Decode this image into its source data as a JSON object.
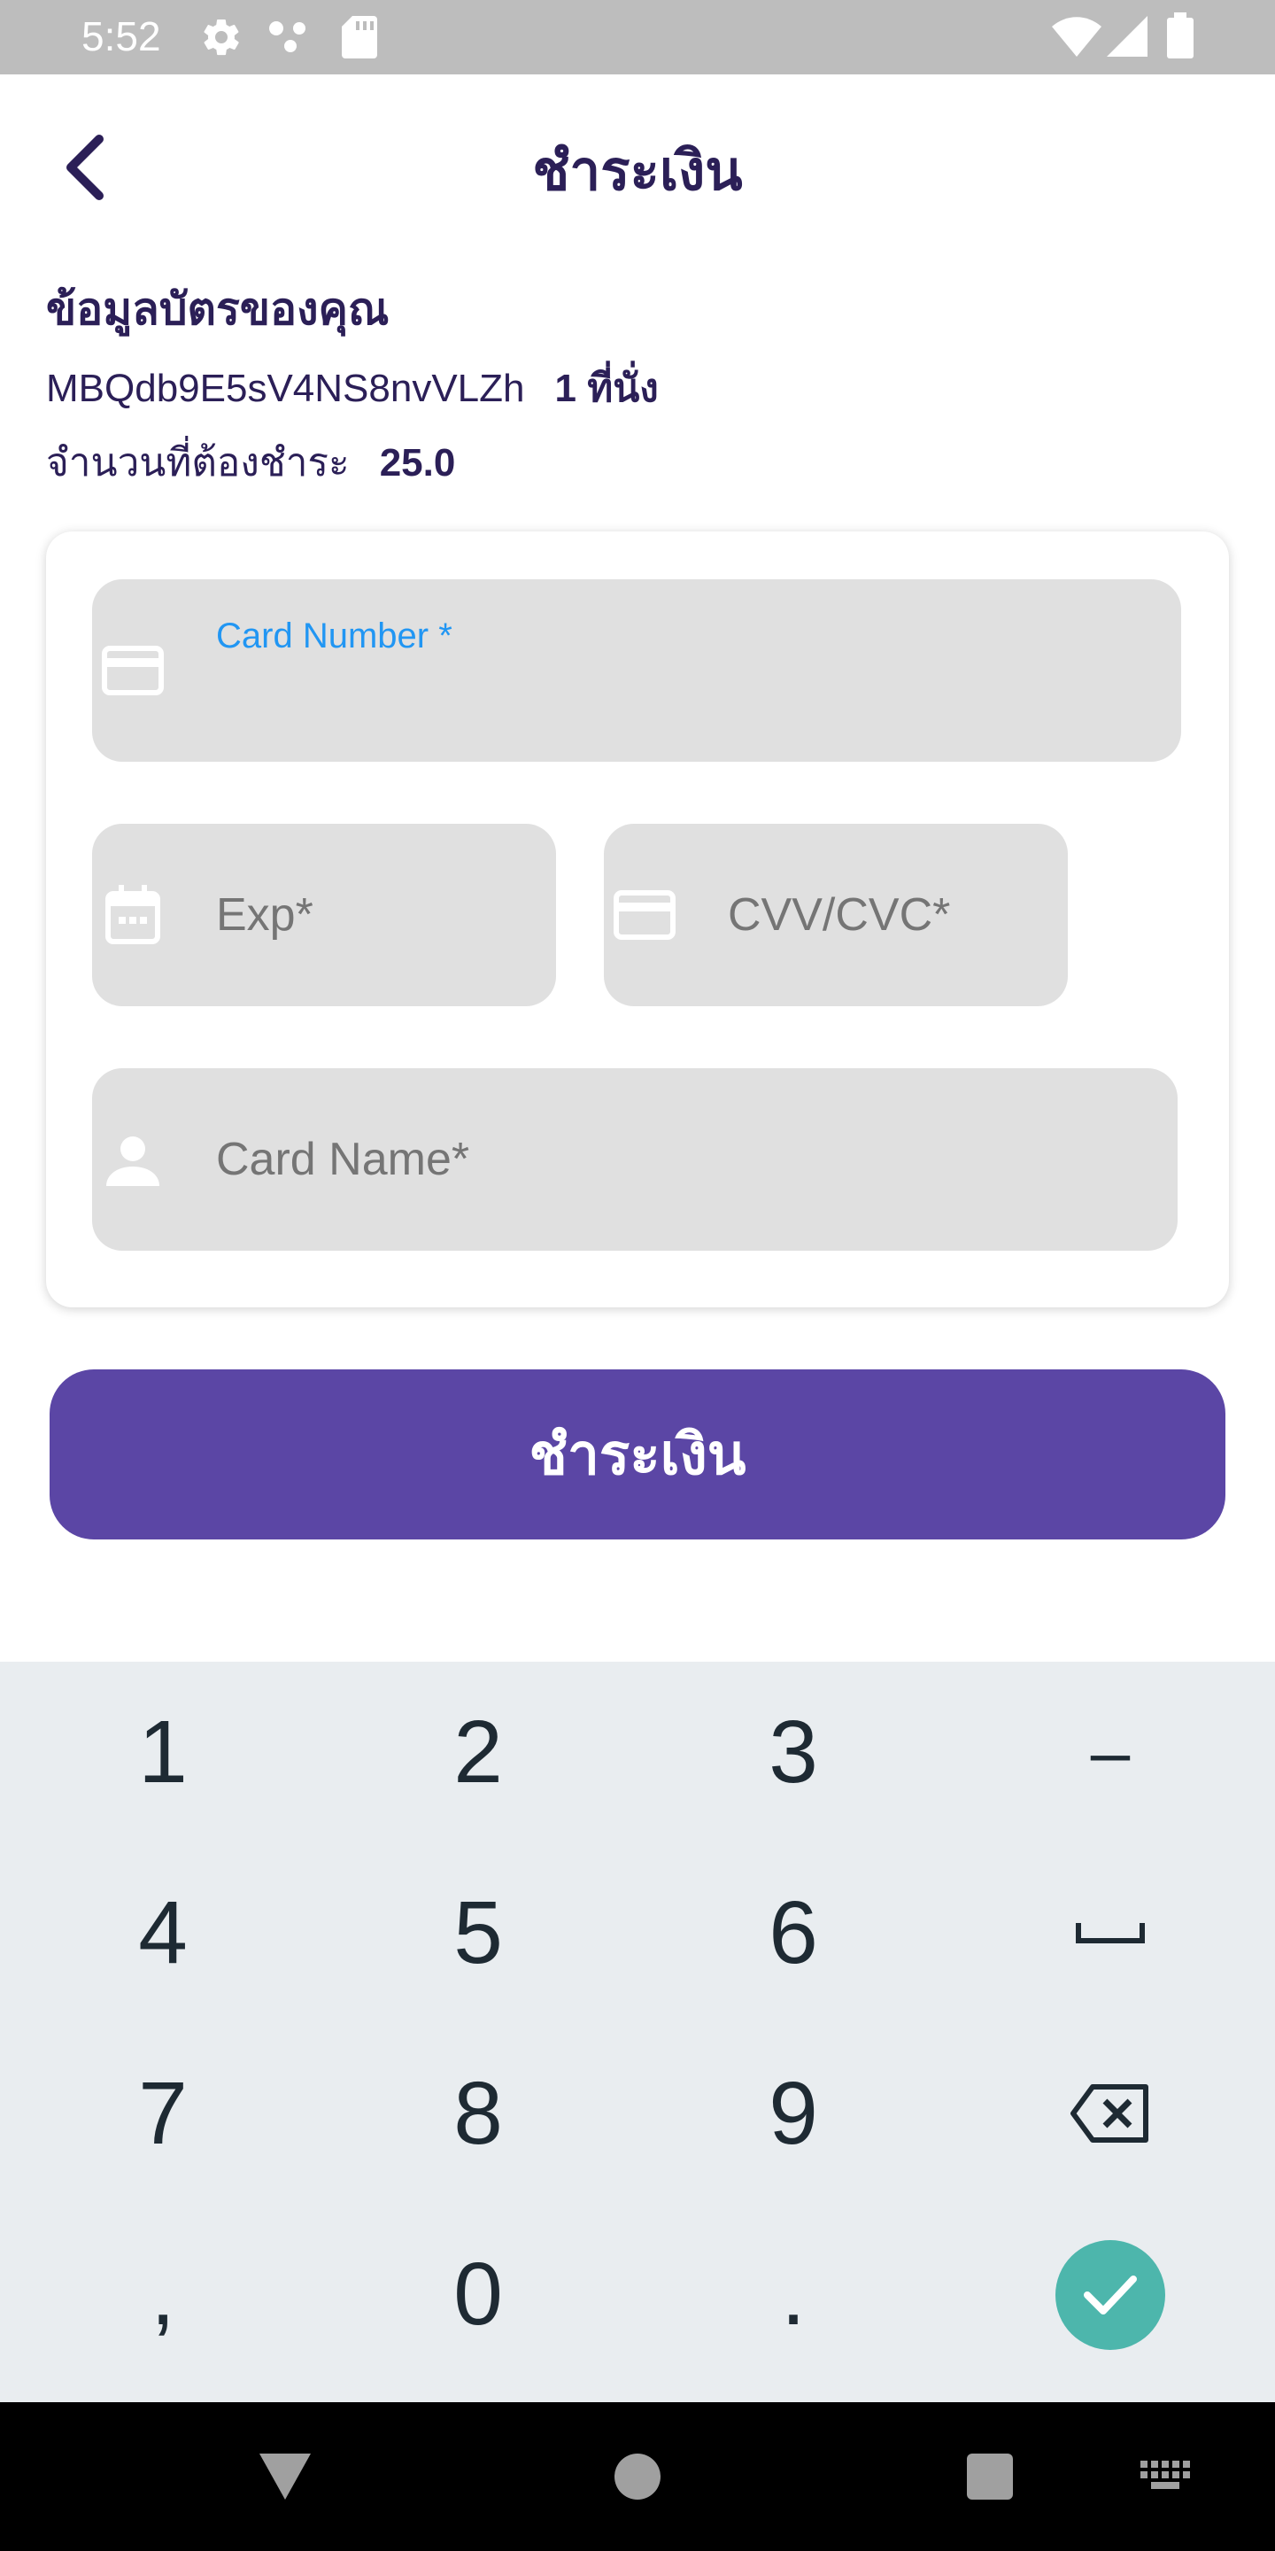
{
  "status_bar": {
    "time": "5:52",
    "icons": [
      "settings-icon",
      "dots-icon",
      "sd-card-icon",
      "wifi-icon",
      "signal-icon",
      "battery-icon"
    ]
  },
  "header": {
    "title": "ชำระเงิน",
    "back_icon": "chevron-left-icon"
  },
  "card_info": {
    "title": "ข้อมูลบัตรของคุณ",
    "booking_code": "MBQdb9E5sV4NS8nvVLZh",
    "seats": "1 ที่นั่ง",
    "amount_label": "จำนวนที่ต้องชำระ",
    "amount_value": "25.0"
  },
  "form": {
    "card_number_label": "Card Number *",
    "exp_label": "Exp*",
    "cvv_label": "CVV/CVC*",
    "card_name_label": "Card Name*"
  },
  "pay_button_label": "ชำระเงิน",
  "keyboard": {
    "rows": [
      [
        "1",
        "2",
        "3",
        "–"
      ],
      [
        "4",
        "5",
        "6",
        "space"
      ],
      [
        "7",
        "8",
        "9",
        "backspace"
      ],
      [
        ",",
        "0",
        ".",
        "done"
      ]
    ]
  },
  "colors": {
    "primary": "#5b46a5",
    "title_text": "#2b1f57",
    "focus_label": "#2196f3",
    "field_bg": "#e0e0e0",
    "done_key": "#4db6ac"
  }
}
